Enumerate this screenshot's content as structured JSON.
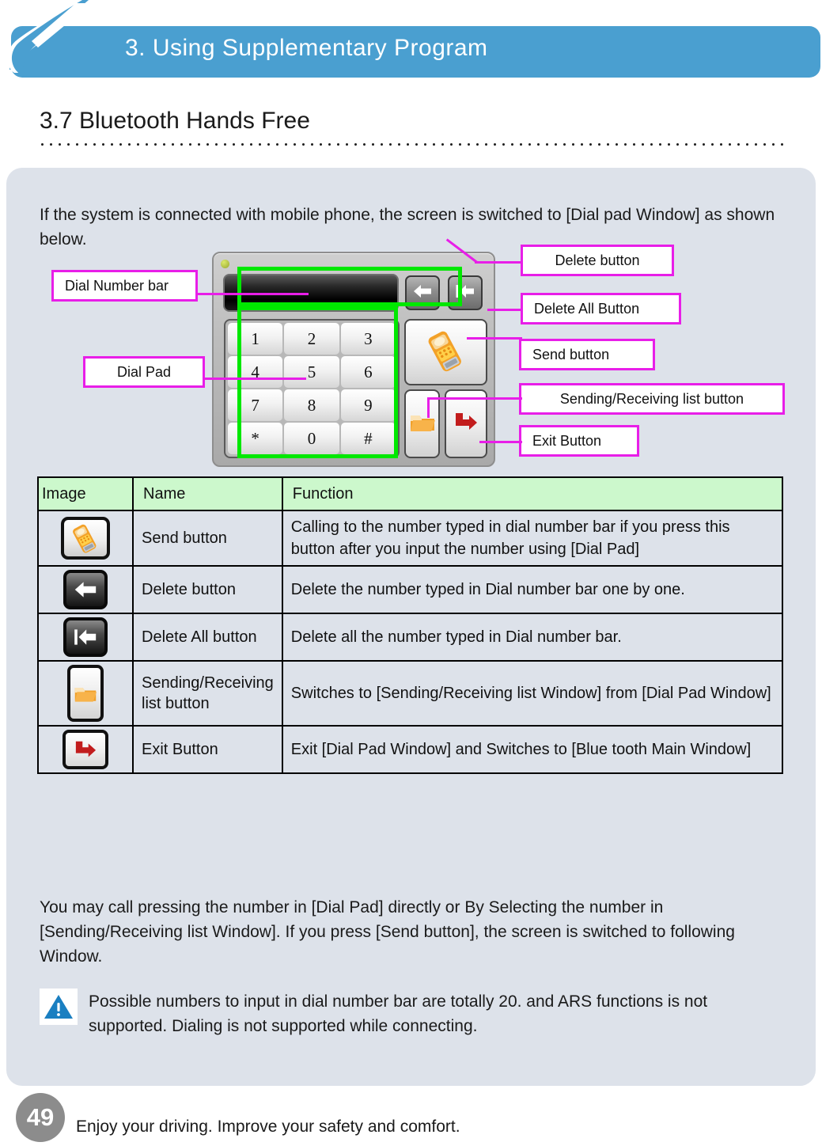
{
  "header": {
    "chapter_title": "3. Using Supplementary Program",
    "logo_name": "company-logo",
    "bar_color": "#4a9fd0"
  },
  "section": {
    "title": "3.7 Bluetooth Hands Free"
  },
  "intro": {
    "text": "If the system is connected with mobile phone, the screen is switched to [Dial pad Window] as shown below."
  },
  "device": {
    "keys": [
      "1",
      "2",
      "3",
      "4",
      "5",
      "6",
      "7",
      "8",
      "9",
      "*",
      "0",
      "#"
    ],
    "number_bar_value": "",
    "delete_icon": "left-arrow-icon",
    "delete_all_icon": "left-arrow-bar-icon",
    "send_icon": "mobile-phone-icon",
    "list_icon": "folder-icon",
    "exit_icon": "right-arrow-exit-icon"
  },
  "callouts": {
    "dial_number_bar": "Dial Number bar",
    "dial_pad": "Dial Pad",
    "delete_button": "Delete button",
    "delete_all_button": "Delete All Button",
    "send_button": "Send button",
    "sending_receiving_list_button": "Sending/Receiving list button",
    "exit_button": "Exit Button",
    "box_border_color": "#e81ee8",
    "highlight_color": "#00e800"
  },
  "table": {
    "headers": [
      "Image",
      "Name",
      "Function"
    ],
    "header_bg": "#ccf8cc",
    "rows": [
      {
        "icon": "send-phone-icon",
        "name": "Send button",
        "function": "Calling to the number typed in dial number bar if you press this button after you input the number using [Dial Pad]"
      },
      {
        "icon": "delete-left-arrow-icon",
        "name": "Delete button",
        "function": "Delete the number typed in Dial number bar one by one."
      },
      {
        "icon": "delete-all-left-arrow-bar-icon",
        "name": "Delete All button",
        "function": "Delete all the number typed in Dial number bar."
      },
      {
        "icon": "sending-receiving-folder-icon",
        "name": "Sending/Receiving list button",
        "function": "Switches to [Sending/Receiving list Window] from [Dial Pad Window]"
      },
      {
        "icon": "exit-right-arrow-icon",
        "name": "Exit Button",
        "function": "Exit [Dial Pad Window] and Switches to [Blue tooth Main Window]"
      }
    ]
  },
  "body": {
    "paragraph": "You may call pressing the number in [Dial Pad] directly or By Selecting the number in [Sending/Receiving list Window]. If you press [Send button], the screen is switched to following Window."
  },
  "warning": {
    "icon": "warning-triangle-icon",
    "text": "Possible numbers to input in dial number bar are totally 20. and ARS functions is not supported. Dialing is not supported while connecting."
  },
  "footer": {
    "page_number": "49",
    "tagline": "Enjoy your driving. Improve your safety and comfort."
  }
}
